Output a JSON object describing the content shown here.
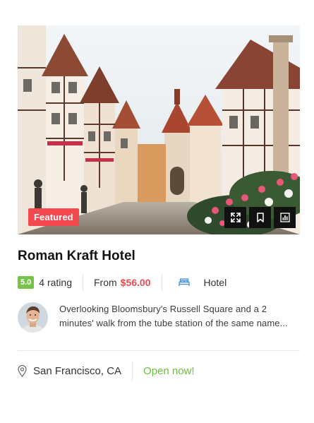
{
  "listing": {
    "badge": "Featured",
    "title": "Roman Kraft Hotel",
    "rating_value": "5.0",
    "rating_label": "4 rating",
    "price_prefix": "From",
    "price": "$56.00",
    "category": "Hotel",
    "description": "Overlooking Bloomsbury's Russell Square and a 2 minutes' walk from the tube station of the same name...",
    "location": "San Francisco, CA",
    "status": "Open now!"
  },
  "icons": {
    "expand": "expand-icon",
    "bookmark": "bookmark-icon",
    "compare": "compare-chart-icon",
    "category": "bed-icon",
    "location": "map-pin-icon"
  },
  "colors": {
    "accent_red": "#f4494f",
    "rating_green": "#77c34a",
    "open_green": "#6bbf3a",
    "action_bg": "#111111"
  }
}
